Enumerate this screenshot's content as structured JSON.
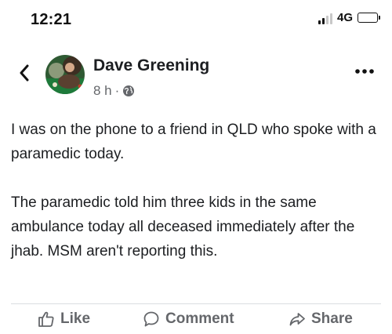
{
  "status_bar": {
    "time": "12:21",
    "network": "4G"
  },
  "post": {
    "author": "Dave Greening",
    "time_ago": "8 h",
    "separator": "·",
    "paragraphs": [
      "I was on the phone to a friend in QLD who spoke with a paramedic today.",
      "The paramedic told him three kids in the same ambulance today all deceased immediately after the jhab. MSM aren't reporting this."
    ]
  },
  "actions": {
    "like": "Like",
    "comment": "Comment",
    "share": "Share"
  },
  "icons": {
    "back": "chevron-left-icon",
    "more": "more-options-icon",
    "audience": "globe-icon",
    "like": "thumbs-up-icon",
    "comment": "speech-bubble-icon",
    "share": "share-arrow-icon"
  },
  "colors": {
    "text": "#1c1e21",
    "secondary": "#65676b",
    "divider": "#dadde1"
  }
}
